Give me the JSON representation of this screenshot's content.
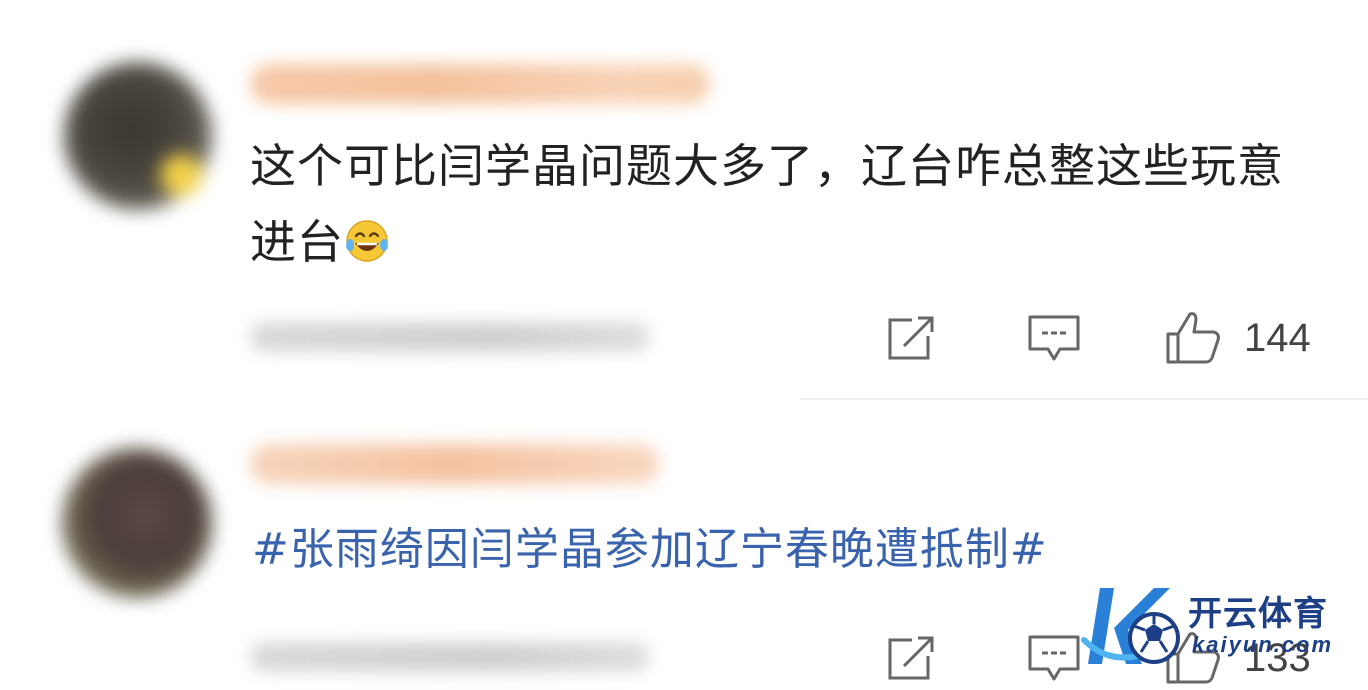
{
  "comments": [
    {
      "text": "这个可比闫学晶问题大多了，辽台咋总整这些玩意进台",
      "emoji": "laughing-crying-emoji",
      "like_count": "144"
    },
    {
      "text": "#张雨绮因闫学晶参加辽宁春晚遭抵制#",
      "like_count": "133"
    }
  ],
  "watermark": {
    "name_cn": "开云体育",
    "domain": "kaiyun.com"
  },
  "colors": {
    "hashtag": "#3a63ad",
    "text": "#222222",
    "icon": "#666666",
    "brand": "#1d3f86"
  }
}
